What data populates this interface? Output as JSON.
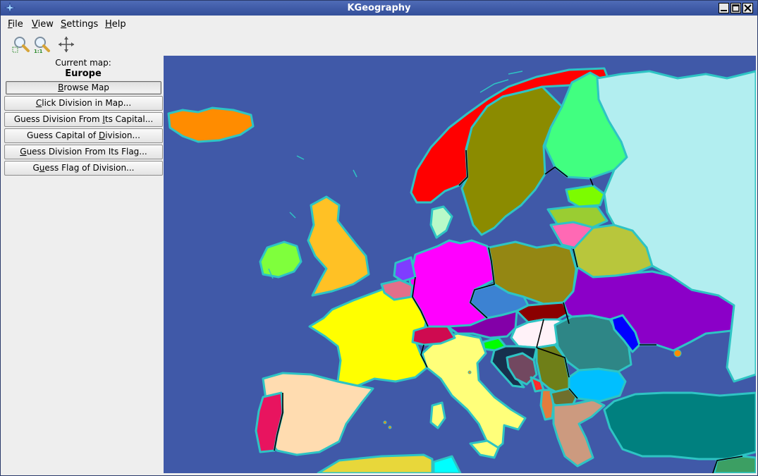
{
  "window": {
    "title": "KGeography"
  },
  "menubar": {
    "items": [
      {
        "label": "File",
        "mnemonic": "F",
        "rest": "ile"
      },
      {
        "label": "View",
        "mnemonic": "V",
        "rest": "iew"
      },
      {
        "label": "Settings",
        "mnemonic": "S",
        "rest": "ettings"
      },
      {
        "label": "Help",
        "mnemonic": "H",
        "rest": "elp"
      }
    ]
  },
  "toolbar": {
    "items": [
      {
        "name": "zoom-in-icon"
      },
      {
        "name": "original-size-icon"
      },
      {
        "name": "move-icon"
      }
    ]
  },
  "sidebar": {
    "current_map_label": "Current map:",
    "current_map_value": "Europe",
    "buttons": [
      {
        "pre": "",
        "mn": "B",
        "post": "rowse Map",
        "active": true
      },
      {
        "pre": "",
        "mn": "C",
        "post": "lick Division in Map...",
        "active": false
      },
      {
        "pre": "Guess Division From ",
        "mn": "I",
        "post": "ts Capital...",
        "active": false
      },
      {
        "pre": "Guess Capital of ",
        "mn": "D",
        "post": "ivision...",
        "active": false
      },
      {
        "pre": "",
        "mn": "G",
        "post": "uess Division From Its Flag...",
        "active": false
      },
      {
        "pre": "G",
        "mn": "u",
        "post": "ess Flag of Division...",
        "active": false
      }
    ]
  },
  "map": {
    "sea_color": "#4059a8",
    "coast_color": "#2ec4c4",
    "border_color": "#000000"
  }
}
